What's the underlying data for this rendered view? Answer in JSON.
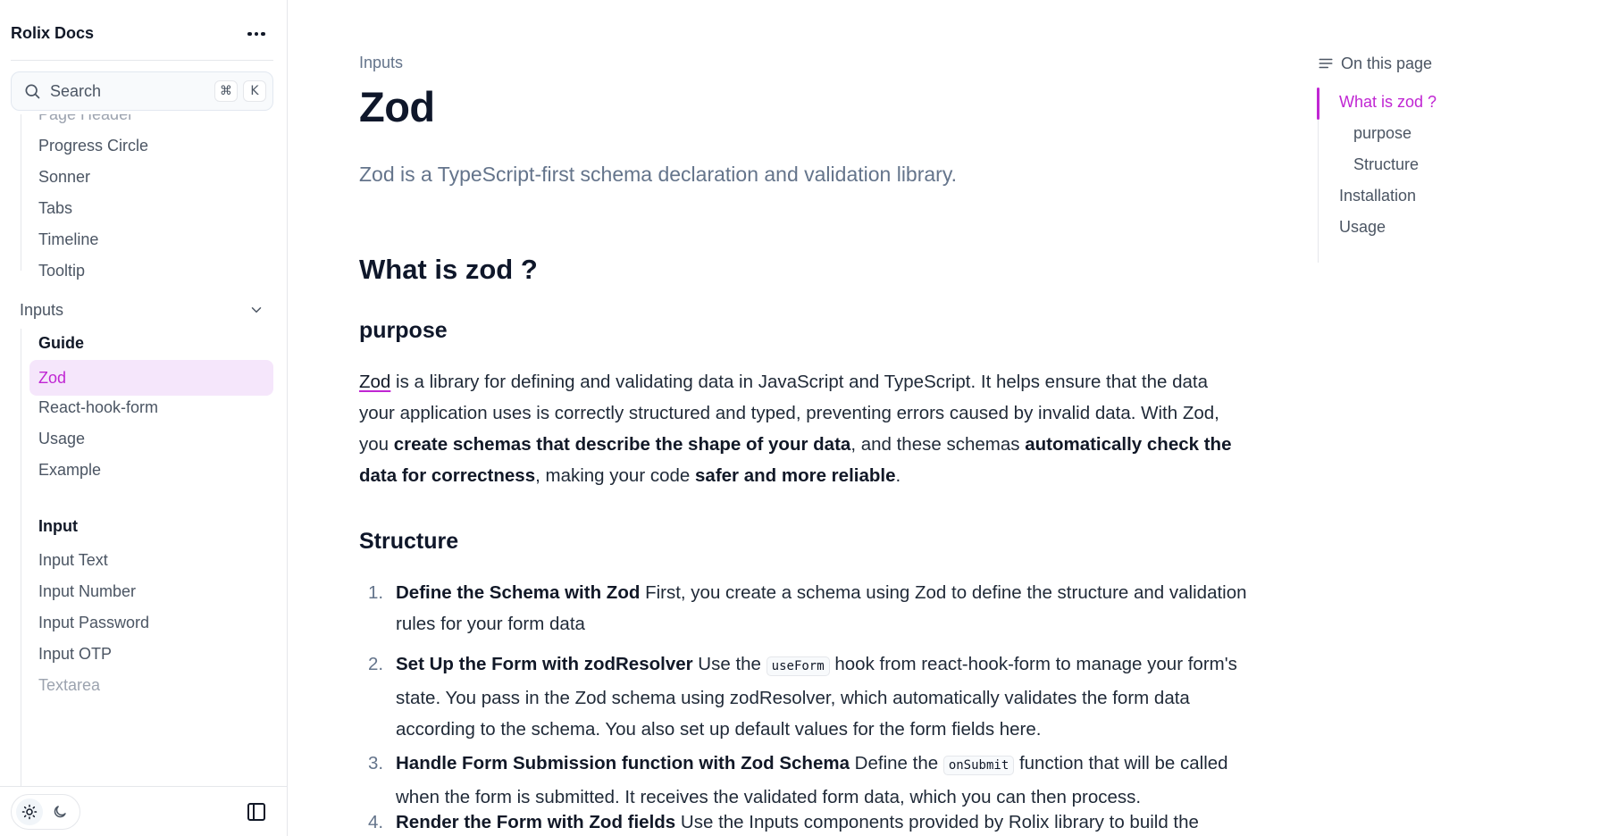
{
  "sidebar": {
    "brand": "Rolix Docs",
    "search": {
      "placeholder": "Search",
      "shortcut_key1": "⌘",
      "shortcut_key2": "K"
    },
    "items_top": [
      "Page Header",
      "Progress Circle",
      "Sonner",
      "Tabs",
      "Timeline",
      "Tooltip"
    ],
    "group_label": "Inputs",
    "guide_heading": "Guide",
    "active_item": "Zod",
    "guide_items": [
      "React-hook-form",
      "Usage",
      "Example"
    ],
    "input_heading": "Input",
    "input_items": [
      "Input Text",
      "Input Number",
      "Input Password",
      "Input OTP",
      "Textarea"
    ]
  },
  "main": {
    "breadcrumb": "Inputs",
    "title": "Zod",
    "lead": "Zod is a TypeScript-first schema declaration and validation library.",
    "h2": "What is zod ?",
    "h3_purpose": "purpose",
    "purpose": {
      "link": "Zod",
      "t1": " is a library for defining and validating data in JavaScript and TypeScript. It helps ensure that the data your application uses is correctly structured and typed, preventing errors caused by invalid data. With Zod, you ",
      "b1": "create schemas that describe the shape of your data",
      "t2": ", and these schemas ",
      "b2": "automatically check the data for correctness",
      "t3": ", making your code ",
      "b3": "safer and more reliable",
      "t4": "."
    },
    "h3_structure": "Structure",
    "steps": [
      {
        "num": "1.",
        "bold": "Define the Schema with Zod",
        "text": " First, you create a schema using Zod to define the structure and validation rules for your form data"
      },
      {
        "num": "2.",
        "bold": "Set Up the Form with zodResolver",
        "pre": " Use the ",
        "code": "useForm",
        "text": " hook from react-hook-form to manage your form's state. You pass in the Zod schema using zodResolver, which automatically validates the form data according to the schema. You also set up default values for the form fields here."
      },
      {
        "num": "3.",
        "bold": "Handle Form Submission function with Zod Schema",
        "pre": " Define the ",
        "code": "onSubmit",
        "text": " function that will be called when the form is submitted. It receives the validated form data, which you can then process."
      },
      {
        "num": "4.",
        "bold": "Render the Form with Zod fields",
        "text": " Use the Inputs components provided by Rolix library to build the"
      }
    ]
  },
  "toc": {
    "heading": "On this page",
    "items": [
      "What is zod ?",
      "purpose",
      "Structure",
      "Installation",
      "Usage"
    ]
  },
  "colors": {
    "accent": "#c026d3",
    "active_bg": "#f5e6fb",
    "muted": "#64748b"
  },
  "icons": [
    "more-icon",
    "search-icon",
    "chevron-down-icon",
    "sun-icon",
    "moon-icon",
    "sidebar-panel-icon",
    "toc-lines-icon"
  ]
}
